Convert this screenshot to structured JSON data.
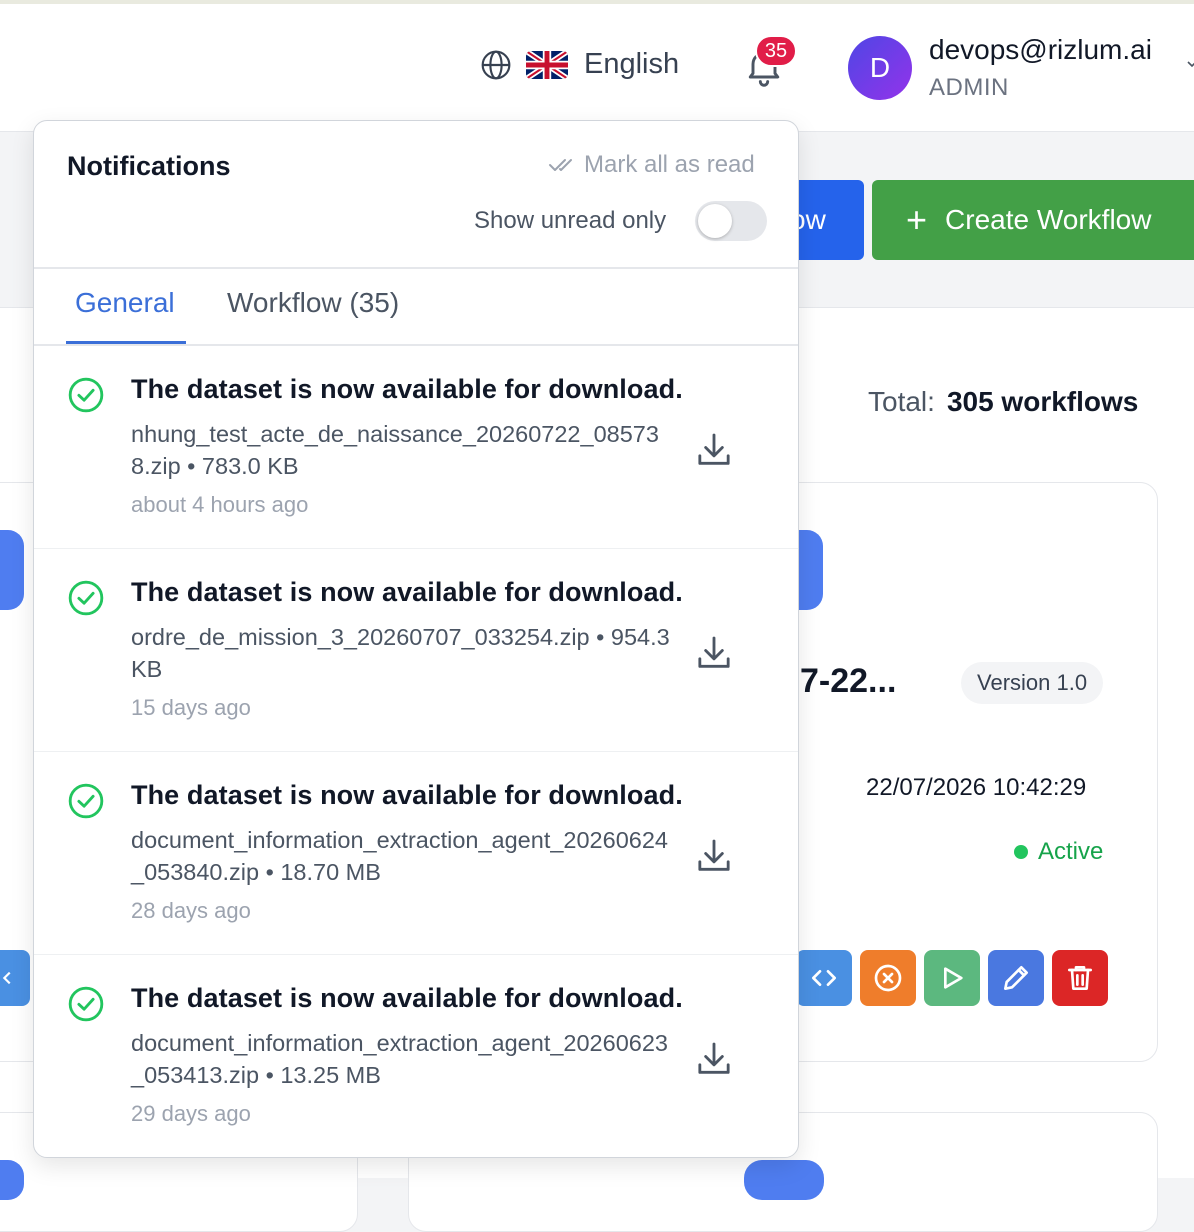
{
  "header": {
    "language_label": "English",
    "notification_count": "35",
    "user": {
      "initial": "D",
      "email": "devops@rizlum.ai",
      "role": "ADMIN"
    }
  },
  "toolbar": {
    "partial_button_label": "ow",
    "create_button_label": "Create Workflow",
    "create_button_icon": "+"
  },
  "summary": {
    "total_label": "Total:",
    "total_value": "305 workflows"
  },
  "workflow_card": {
    "title_fragment": "7-22...",
    "version": "Version 1.0",
    "date": "22/07/2026 10:42:29",
    "status": "Active"
  },
  "notifications": {
    "title": "Notifications",
    "mark_all_label": "Mark all as read",
    "show_unread_label": "Show unread only",
    "show_unread_enabled": false,
    "tabs": [
      {
        "label": "General",
        "active": true
      },
      {
        "label": "Workflow (35)",
        "active": false
      }
    ],
    "items": [
      {
        "title": "The dataset is now available for download.",
        "file": "nhung_test_acte_de_naissance_20260722_085738.zip • 783.0 KB",
        "time": "about 4 hours ago"
      },
      {
        "title": "The dataset is now available for download.",
        "file": "ordre_de_mission_3_20260707_033254.zip • 954.3 KB",
        "time": "15 days ago"
      },
      {
        "title": "The dataset is now available for download.",
        "file": "document_information_extraction_agent_20260624_053840.zip • 18.70 MB",
        "time": "28 days ago"
      },
      {
        "title": "The dataset is now available for download.",
        "file": "document_information_extraction_agent_20260623_053413.zip • 13.25 MB",
        "time": "29 days ago"
      }
    ]
  },
  "colors": {
    "primary_blue": "#2563eb",
    "create_green": "#43a047",
    "success_green": "#22c55e",
    "badge_red": "#e11d48",
    "tab_active": "#3b6fd8"
  }
}
